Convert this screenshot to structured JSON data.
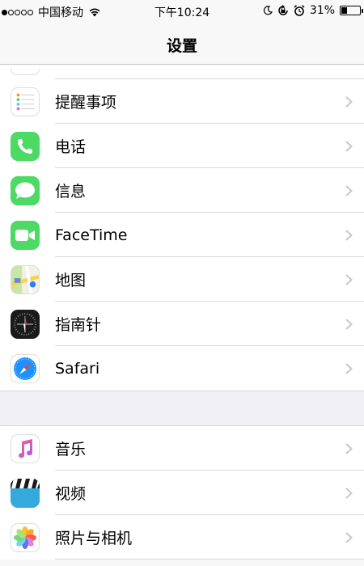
{
  "status_bar": {
    "carrier": "中国移动",
    "time": "下午10:24",
    "battery": "31%",
    "battery_level": 0.31,
    "signal_dots": 1,
    "icons": [
      "wifi-icon",
      "moon-icon",
      "rotation-lock-icon",
      "alarm-icon",
      "battery-icon"
    ]
  },
  "nav": {
    "title": "设置"
  },
  "groups": [
    {
      "items": [
        {
          "label": "提醒事项",
          "icon": "reminders-icon"
        },
        {
          "label": "电话",
          "icon": "phone-icon"
        },
        {
          "label": "信息",
          "icon": "messages-icon"
        },
        {
          "label": "FaceTime",
          "icon": "facetime-icon"
        },
        {
          "label": "地图",
          "icon": "maps-icon"
        },
        {
          "label": "指南针",
          "icon": "compass-icon"
        },
        {
          "label": "Safari",
          "icon": "safari-icon"
        }
      ]
    },
    {
      "items": [
        {
          "label": "音乐",
          "icon": "music-icon"
        },
        {
          "label": "视频",
          "icon": "videos-icon"
        },
        {
          "label": "照片与相机",
          "icon": "photos-icon"
        }
      ]
    }
  ],
  "colors": {
    "phone_green": "#4cd964",
    "compass_black": "#1a1a1a",
    "safari_blue": "#1e90ff",
    "videos_blue": "#34aadc",
    "music_pink": "#ff2d55",
    "chevron": "#c7c7cc"
  }
}
